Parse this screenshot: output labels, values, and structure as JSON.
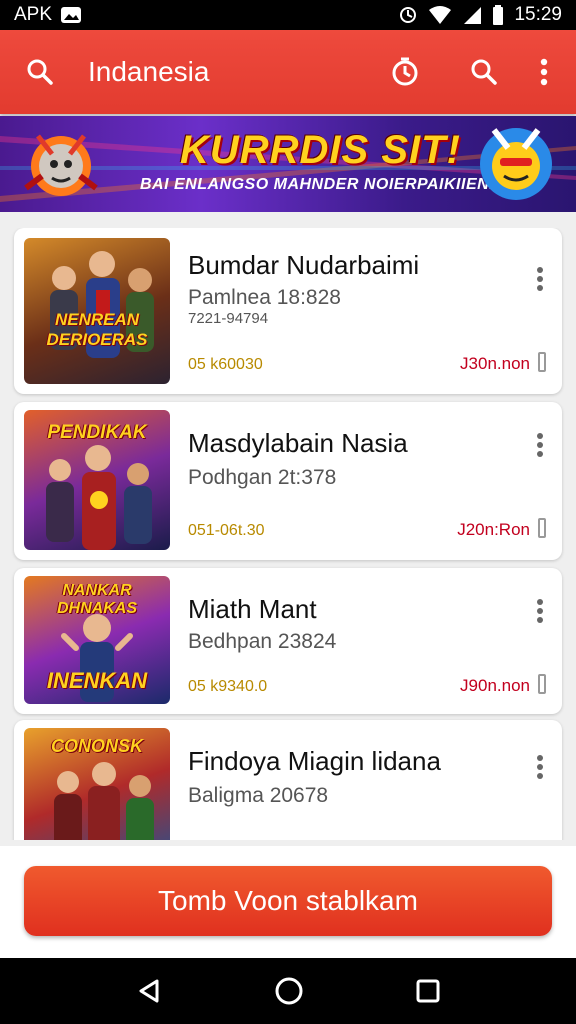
{
  "status": {
    "left_text": "APK",
    "time": "15:29"
  },
  "app_bar": {
    "title": "Indanesia"
  },
  "banner": {
    "title": "KURRDIS SIT!",
    "subtitle": "BAI ENLANGSO MAHNDER NOIERPAIKIIENI"
  },
  "list": [
    {
      "thumb_text": "NENREAN DERIOERAS",
      "title": "Bumdar Nudarbaimi",
      "subtitle": "Pamlnea 18:828",
      "subtitle2": "7221-94794",
      "date": "05 k60030",
      "price": "J30n.non",
      "thumb_colors": [
        "#d48a2a",
        "#6b2f18",
        "#2c2230"
      ]
    },
    {
      "thumb_text": "PENDIKAK",
      "title": "Masdylabain Nasia",
      "subtitle": "Podhgan 2t:378",
      "subtitle2": "",
      "date": "051-06t.30",
      "price": "J20n:Ron",
      "thumb_colors": [
        "#e2602a",
        "#7a2a9a",
        "#1a1c4a"
      ]
    },
    {
      "thumb_text": "NANKAR DHNAKAS",
      "thumb_text2": "INENKAN",
      "title": "Miath Mant",
      "subtitle": "Bedhpan 23824",
      "subtitle2": "",
      "date": "05 k9340.0",
      "price": "J90n.non",
      "thumb_colors": [
        "#e47a20",
        "#8a2bb0",
        "#1b2a6a"
      ]
    },
    {
      "thumb_text": "CONONSK",
      "title": "Findoya Miagin lidana",
      "subtitle": "Baligma 20678",
      "subtitle2": "",
      "date": "",
      "price": "",
      "thumb_colors": [
        "#e8a12c",
        "#b02a2a",
        "#2a4f8a"
      ]
    }
  ],
  "cta": {
    "label": "Tomb Voon stablkam"
  },
  "colors": {
    "accent": "#e53a2e",
    "price": "#c2001e",
    "date": "#b88a00"
  }
}
